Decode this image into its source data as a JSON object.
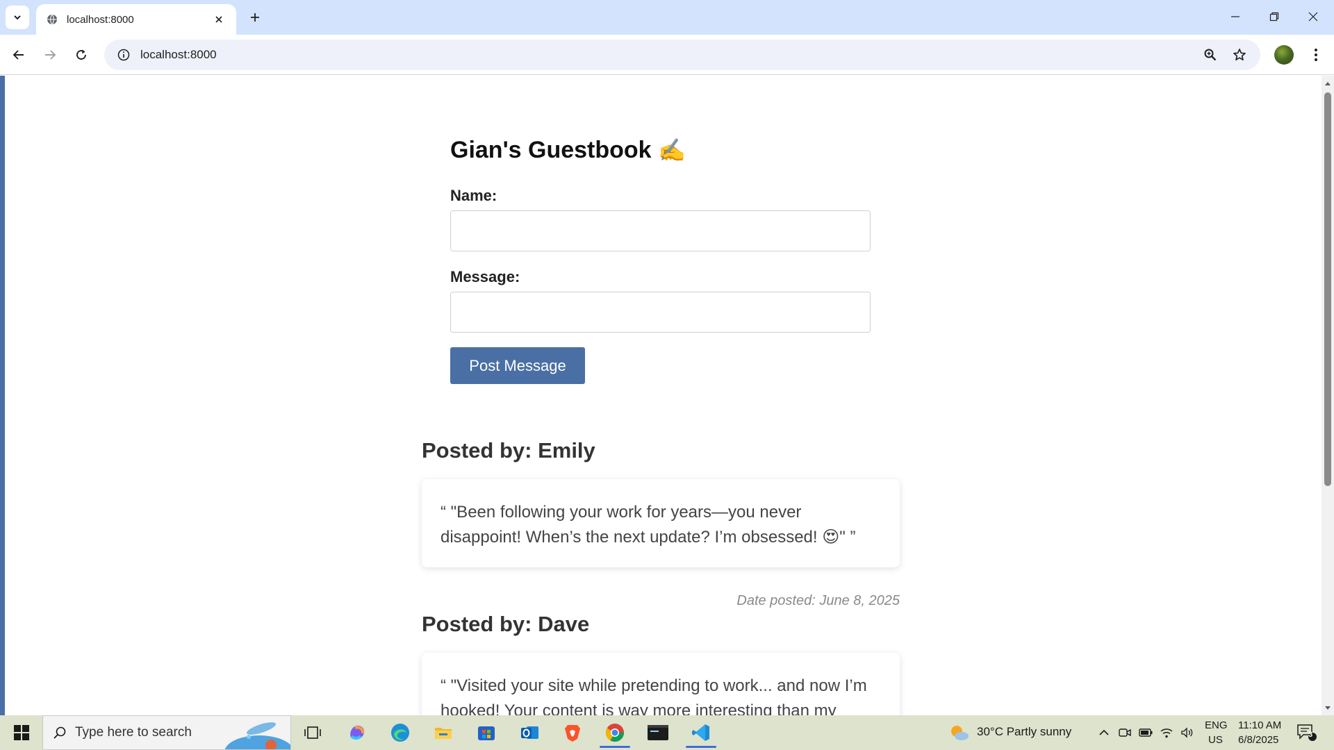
{
  "browser": {
    "tab_title": "localhost:8000",
    "url": "localhost:8000"
  },
  "page": {
    "title": "Gian's Guestbook",
    "title_emoji": "✍️",
    "name_label": "Name:",
    "name_value": "",
    "message_label": "Message:",
    "message_value": "",
    "submit_label": "Post Message"
  },
  "posts": [
    {
      "author": "Posted by: Emily",
      "message": "“ \"Been following your work for years—you never disappoint! When’s the next update? I’m obsessed! 😍\" ”",
      "date": "Date posted: June 8, 2025"
    },
    {
      "author": "Posted by: Dave",
      "message": "“ \"Visited your site while pretending to work... and now I’m hooked! Your content is way more interesting than my"
    }
  ],
  "taskbar": {
    "search_placeholder": "Type here to search",
    "weather": "30°C  Partly sunny",
    "lang_top": "ENG",
    "lang_bottom": "US",
    "time": "11:10 AM",
    "date": "6/8/2025",
    "notification_count": "3"
  },
  "colors": {
    "accent": "#4a6fa5",
    "tab_strip": "#d3e3fd",
    "taskbar": "#dde3cc"
  }
}
